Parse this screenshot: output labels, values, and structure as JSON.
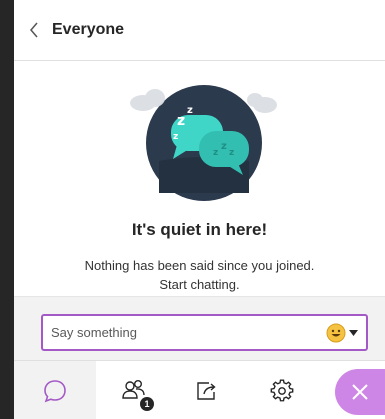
{
  "header": {
    "title": "Everyone"
  },
  "empty_state": {
    "title": "It's quiet in here!",
    "message_line1": "Nothing has been said since you joined.",
    "message_line2": "Start chatting."
  },
  "chat_input": {
    "placeholder": "Say something"
  },
  "participants": {
    "badge_count": "1"
  },
  "icons": {
    "back": "chevron-left-icon",
    "emoji": "smiley-icon",
    "chat": "chat-bubble-icon",
    "participants": "people-icon",
    "share": "share-icon",
    "settings": "gear-icon",
    "close": "close-icon"
  },
  "colors": {
    "accent": "#a45ac6",
    "close_button": "#ce86e6",
    "illustration_bg": "#2c3a4d",
    "bubble": "#3fd6c8"
  }
}
